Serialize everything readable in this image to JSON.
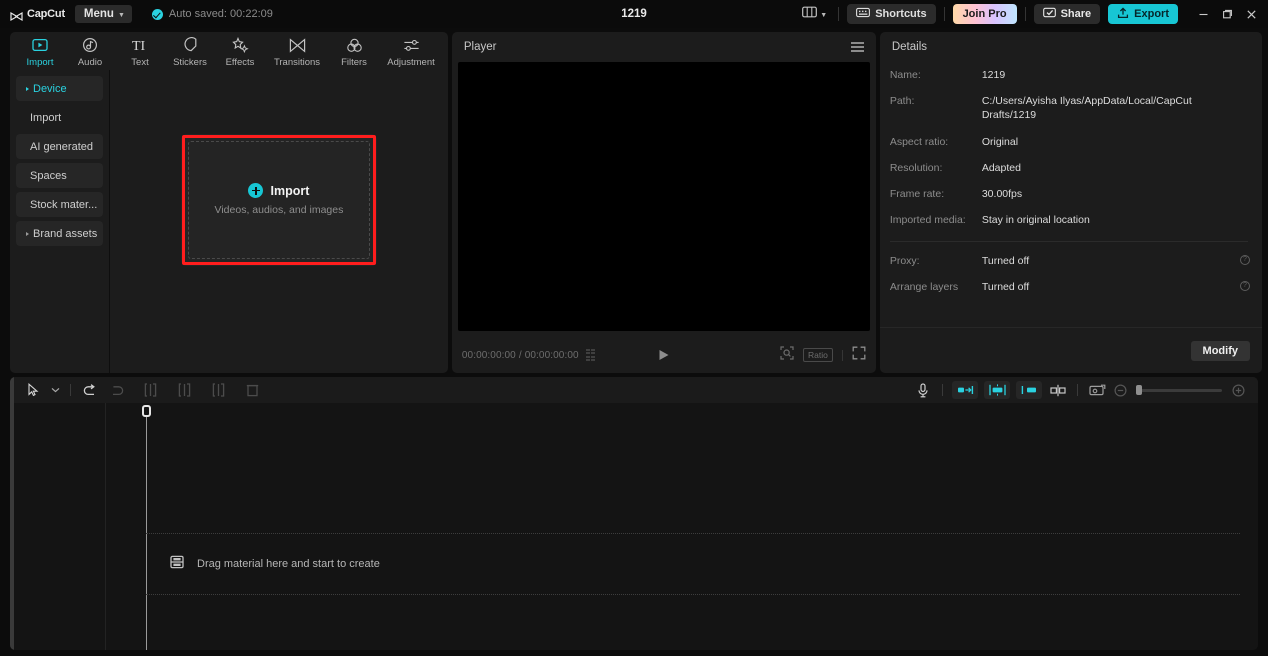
{
  "titlebar": {
    "app_name": "CapCut",
    "menu_label": "Menu",
    "autosave_text": "Auto saved: 00:22:09",
    "project_title": "1219",
    "layout_icon": "panel-layout-icon",
    "shortcuts_label": "Shortcuts",
    "join_pro_label": "Join Pro",
    "share_label": "Share",
    "export_label": "Export",
    "minimize": "–",
    "maximize": "❐",
    "close": "✕"
  },
  "media_panel": {
    "tabs": [
      {
        "label": "Import",
        "icon": "import-icon",
        "active": true
      },
      {
        "label": "Audio",
        "icon": "audio-icon",
        "active": false
      },
      {
        "label": "Text",
        "icon": "text-icon",
        "active": false
      },
      {
        "label": "Stickers",
        "icon": "stickers-icon",
        "active": false
      },
      {
        "label": "Effects",
        "icon": "effects-icon",
        "active": false
      },
      {
        "label": "Transitions",
        "icon": "transitions-icon",
        "active": false
      },
      {
        "label": "Filters",
        "icon": "filters-icon",
        "active": false
      },
      {
        "label": "Adjustment",
        "icon": "adjustment-icon",
        "active": false
      }
    ],
    "side_items": [
      {
        "label": "Device",
        "expandable": true,
        "active": true,
        "filled": true
      },
      {
        "label": "Import",
        "expandable": false,
        "active": false,
        "filled": false
      },
      {
        "label": "AI generated",
        "expandable": false,
        "active": false,
        "filled": true
      },
      {
        "label": "Spaces",
        "expandable": false,
        "active": false,
        "filled": true
      },
      {
        "label": "Stock mater...",
        "expandable": false,
        "active": false,
        "filled": true
      },
      {
        "label": "Brand assets",
        "expandable": true,
        "active": false,
        "filled": true
      }
    ],
    "dropzone": {
      "title": "Import",
      "subtitle": "Videos, audios, and images",
      "plus_icon": "plus-circle-icon",
      "highlight_color": "#ff1d1d"
    }
  },
  "player": {
    "title": "Player",
    "menu_icon": "hamburger-icon",
    "current_time": "00:00:00:00",
    "separator": "/",
    "total_time": "00:00:00:00",
    "grid_icon": "grid-icon",
    "play_icon": "play-icon",
    "zoom_icon": "zoom-tool-icon",
    "ratio_label": "Ratio",
    "fullscreen_icon": "fullscreen-icon"
  },
  "details": {
    "title": "Details",
    "rows": [
      {
        "label": "Name:",
        "value": "1219",
        "info": false
      },
      {
        "label": "Path:",
        "value": "C:/Users/Ayisha Ilyas/AppData/Local/CapCut Drafts/1219",
        "info": false
      },
      {
        "label": "Aspect ratio:",
        "value": "Original",
        "info": false
      },
      {
        "label": "Resolution:",
        "value": "Adapted",
        "info": false
      },
      {
        "label": "Frame rate:",
        "value": "30.00fps",
        "info": false
      },
      {
        "label": "Imported media:",
        "value": "Stay in original location",
        "info": false
      }
    ],
    "rows2": [
      {
        "label": "Proxy:",
        "value": "Turned off",
        "info": true
      },
      {
        "label": "Arrange layers",
        "value": "Turned off",
        "info": true
      }
    ],
    "modify_label": "Modify",
    "info_glyph": "?"
  },
  "timeline": {
    "tools_left": [
      {
        "name": "select-arrow-icon",
        "enabled": true
      },
      {
        "name": "chevron-down-icon",
        "enabled": true
      },
      {
        "name": "undo-icon",
        "enabled": true
      },
      {
        "name": "redo-icon",
        "enabled": false
      },
      {
        "name": "split-left-icon",
        "enabled": false
      },
      {
        "name": "split-icon",
        "enabled": false
      },
      {
        "name": "split-right-icon",
        "enabled": false
      },
      {
        "name": "delete-icon",
        "enabled": false
      }
    ],
    "tools_right": [
      {
        "name": "microphone-icon"
      },
      {
        "name": "track-in-icon"
      },
      {
        "name": "track-mid-icon"
      },
      {
        "name": "track-out-icon"
      },
      {
        "name": "split-clip-icon"
      },
      {
        "name": "preview-card-icon"
      },
      {
        "name": "zoom-out-icon"
      },
      {
        "name": "zoom-in-icon"
      }
    ],
    "dropzone_text": "Drag material here and start to create",
    "dropzone_icon": "film-strip-icon",
    "playhead_position": "0",
    "zoom_value": 0
  },
  "colors": {
    "accent": "#2ad2e0",
    "export": "#17c6d4",
    "highlight": "#ff1d1d",
    "panel_bg": "#1c1c1c",
    "app_bg": "#0c0c0c"
  }
}
